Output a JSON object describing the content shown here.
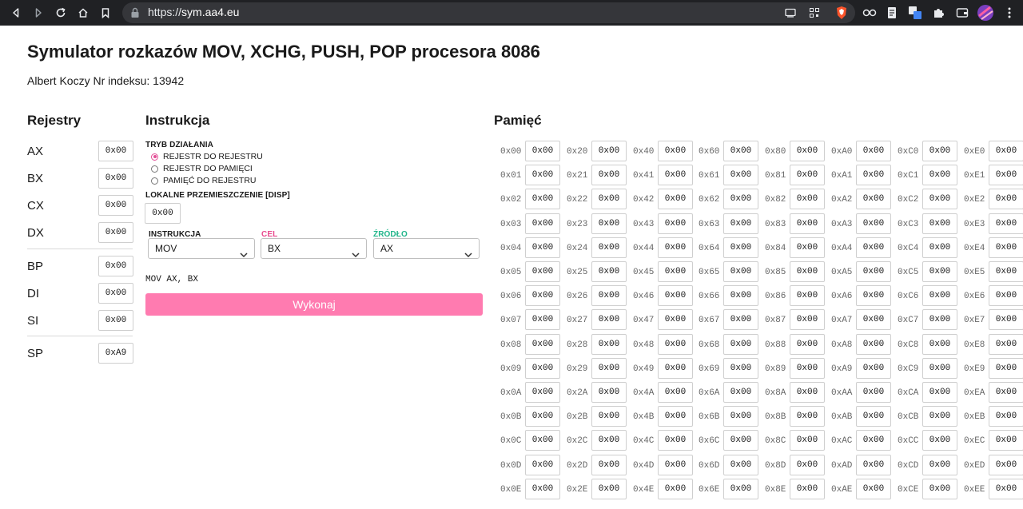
{
  "browser": {
    "url_scheme": "https://",
    "url_host": "sym.aa4.eu"
  },
  "page": {
    "title": "Symulator rozkazów MOV, XCHG, PUSH, POP procesora 8086",
    "author": "Albert Koczy Nr indeksu: 13942"
  },
  "registers": {
    "heading": "Rejestry",
    "items": [
      {
        "name": "AX",
        "value": "0x00"
      },
      {
        "name": "BX",
        "value": "0x00"
      },
      {
        "name": "CX",
        "value": "0x00"
      },
      {
        "name": "DX",
        "value": "0x00"
      },
      {
        "name": "BP",
        "value": "0x00"
      },
      {
        "name": "DI",
        "value": "0x00"
      },
      {
        "name": "SI",
        "value": "0x00"
      },
      {
        "name": "SP",
        "value": "0xA9"
      }
    ]
  },
  "instruction": {
    "heading": "Instrukcja",
    "mode_heading": "TRYB DZIAŁANIA",
    "modes": [
      "REJESTR DO REJESTRU",
      "REJESTR DO PAMIĘCI",
      "PAMIĘĆ DO REJESTRU"
    ],
    "disp_heading": "LOKALNE PRZEMIESZCZENIE [DISP]",
    "disp_value": "0x00",
    "instr_label": "INSTRUKCJA",
    "instr_value": "MOV",
    "dest_label": "CEL",
    "dest_value": "BX",
    "src_label": "ŹRÓDŁO",
    "src_value": "AX",
    "preview": "MOV AX, BX",
    "execute_label": "Wykonaj",
    "colors": {
      "accent": "#ff7bb0",
      "dest": "#e94b8f",
      "src": "#21b58a"
    }
  },
  "memory": {
    "heading": "Pamięć",
    "columns": [
      [
        "0x00",
        "0x01",
        "0x02",
        "0x03",
        "0x04",
        "0x05",
        "0x06",
        "0x07",
        "0x08",
        "0x09",
        "0x0A",
        "0x0B",
        "0x0C",
        "0x0D",
        "0x0E"
      ],
      [
        "0x20",
        "0x21",
        "0x22",
        "0x23",
        "0x24",
        "0x25",
        "0x26",
        "0x27",
        "0x28",
        "0x29",
        "0x2A",
        "0x2B",
        "0x2C",
        "0x2D",
        "0x2E"
      ],
      [
        "0x40",
        "0x41",
        "0x42",
        "0x43",
        "0x44",
        "0x45",
        "0x46",
        "0x47",
        "0x48",
        "0x49",
        "0x4A",
        "0x4B",
        "0x4C",
        "0x4D",
        "0x4E"
      ],
      [
        "0x60",
        "0x61",
        "0x62",
        "0x63",
        "0x64",
        "0x65",
        "0x66",
        "0x67",
        "0x68",
        "0x69",
        "0x6A",
        "0x6B",
        "0x6C",
        "0x6D",
        "0x6E"
      ],
      [
        "0x80",
        "0x81",
        "0x82",
        "0x83",
        "0x84",
        "0x85",
        "0x86",
        "0x87",
        "0x88",
        "0x89",
        "0x8A",
        "0x8B",
        "0x8C",
        "0x8D",
        "0x8E"
      ],
      [
        "0xA0",
        "0xA1",
        "0xA2",
        "0xA3",
        "0xA4",
        "0xA5",
        "0xA6",
        "0xA7",
        "0xA8",
        "0xA9",
        "0xAA",
        "0xAB",
        "0xAC",
        "0xAD",
        "0xAE"
      ],
      [
        "0xC0",
        "0xC1",
        "0xC2",
        "0xC3",
        "0xC4",
        "0xC5",
        "0xC6",
        "0xC7",
        "0xC8",
        "0xC9",
        "0xCA",
        "0xCB",
        "0xCC",
        "0xCD",
        "0xCE"
      ],
      [
        "0xE0",
        "0xE1",
        "0xE2",
        "0xE3",
        "0xE4",
        "0xE5",
        "0xE6",
        "0xE7",
        "0xE8",
        "0xE9",
        "0xEA",
        "0xEB",
        "0xEC",
        "0xED",
        "0xEE"
      ]
    ],
    "cell_value": "0x00"
  }
}
